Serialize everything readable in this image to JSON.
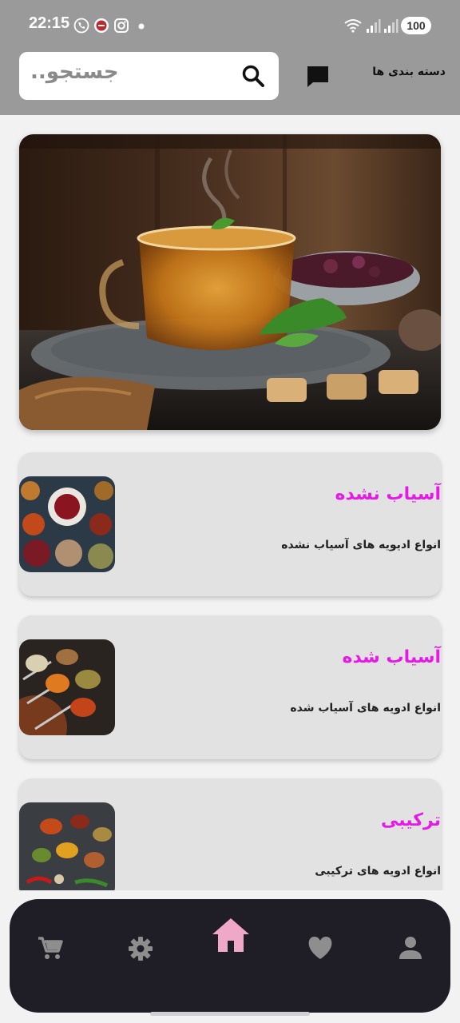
{
  "status_bar": {
    "time": "22:15",
    "battery": "100"
  },
  "header": {
    "search_placeholder": "جستجو..",
    "categories_label": "دسته بندی ها"
  },
  "categories": [
    {
      "title": "آسیاب نشده",
      "subtitle": "انواع ادیویه های آسیاب نشده"
    },
    {
      "title": "آسیاب شده",
      "subtitle": "انواع ادویه های آسیاب شده"
    },
    {
      "title": "ترکیبی",
      "subtitle": "انواع ادویه های ترکیبی"
    }
  ],
  "bottom_nav": {
    "items": [
      "cart-icon",
      "settings-icon",
      "home-icon",
      "heart-icon",
      "person-icon"
    ],
    "active": "home-icon"
  },
  "colors": {
    "header_bg": "#9a9a9a",
    "title_accent": "#e619e6",
    "nav_bg": "#1f1e26",
    "nav_icon": "#8e8e8e",
    "nav_active": "#f0a8c8"
  }
}
